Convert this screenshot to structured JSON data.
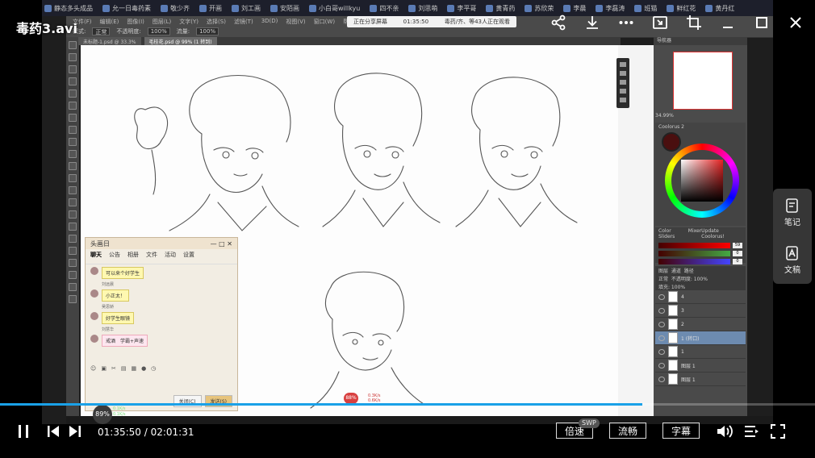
{
  "player": {
    "title": "毒药3.avi",
    "current_time": "01:35:50",
    "duration": "02:01:31",
    "time_separator": " / ",
    "progress": 0.7885,
    "speed_label": "倍速",
    "speed_badge": "SWP",
    "quality_label": "流畅",
    "subtitle_label": "字幕",
    "side_panel": {
      "notes_label": "笔记",
      "transcript_label": "文稿"
    }
  },
  "video": {
    "taskbar_items": [
      "静态多头成品",
      "允一日毒药素",
      "敬少齐",
      "开画",
      "刘工画",
      "安陌画",
      "小白哥willkyu",
      "四不亲",
      "刘思萌",
      "李平哥",
      "黄青药",
      "苏欣荣",
      "李晨",
      "李磊涛",
      "班猫",
      "鲜红花",
      "黄丹红"
    ],
    "ps_menu": [
      "文件(F)",
      "编辑(E)",
      "图像(I)",
      "图层(L)",
      "文字(Y)",
      "选择(S)",
      "滤镜(T)",
      "3D(D)",
      "视图(V)",
      "窗口(W)",
      "帮助(H)"
    ],
    "ps_options": [
      "模式:",
      "正常",
      "不透明度:",
      "100%",
      "流量:",
      "100%"
    ],
    "stream_banner": {
      "left": "正在分享屏幕",
      "time": "01:35:50",
      "right": "毒药/齐、等43人正在观看"
    },
    "ps_tabs": [
      "未标题-1.psd @ 33.3%",
      "毛桂花.psd @ 99% (1 转到)"
    ],
    "navigator": {
      "title": "导航器",
      "zoom": "34.99%"
    },
    "color_panel": {
      "title": "Coolorus 2",
      "main_color": "#4a0f0f"
    },
    "sliders": {
      "tabs": [
        "Color Sliders",
        "Mixer",
        "Update Coolorus!"
      ],
      "values": [
        "59",
        "0",
        "0"
      ]
    },
    "layers": {
      "tabs": [
        "图层",
        "通道",
        "路径"
      ],
      "blend": "正常",
      "opacity": "不透明度: 100%",
      "fill": "填充: 100%",
      "items": [
        {
          "name": "4",
          "selected": false
        },
        {
          "name": "3",
          "selected": false
        },
        {
          "name": "2",
          "selected": false
        },
        {
          "name": "1 (转口)",
          "selected": true
        },
        {
          "name": "1",
          "selected": false
        },
        {
          "name": "图层 1",
          "selected": false
        },
        {
          "name": "图层 1",
          "selected": false
        }
      ]
    },
    "chat": {
      "title": "头画日",
      "tabs": [
        "聊天",
        "公告",
        "相册",
        "文件",
        "活动",
        "设置"
      ],
      "messages": [
        {
          "name": "",
          "text": "可以来个好学生",
          "style": "yellow"
        },
        {
          "name": "刘远晨",
          "text": "小正太！",
          "style": "yellow"
        },
        {
          "name": "吴思娇",
          "text": "好学生眼镜",
          "style": "yellow"
        },
        {
          "name": "刘慧华",
          "text": "戒酒　学霸+声速",
          "style": "pink"
        }
      ],
      "close_btn": "关闭(C)",
      "send_btn": "发送(S)"
    },
    "net_badge": "89%",
    "net_stats": [
      "0.1K/s",
      "0.1K/s"
    ],
    "ctr_badge": "88%",
    "ctr_stats": [
      "0.3K/s",
      "0.6K/s"
    ]
  },
  "colors": {
    "accent": "#1aa1e8",
    "background": "#000000"
  }
}
